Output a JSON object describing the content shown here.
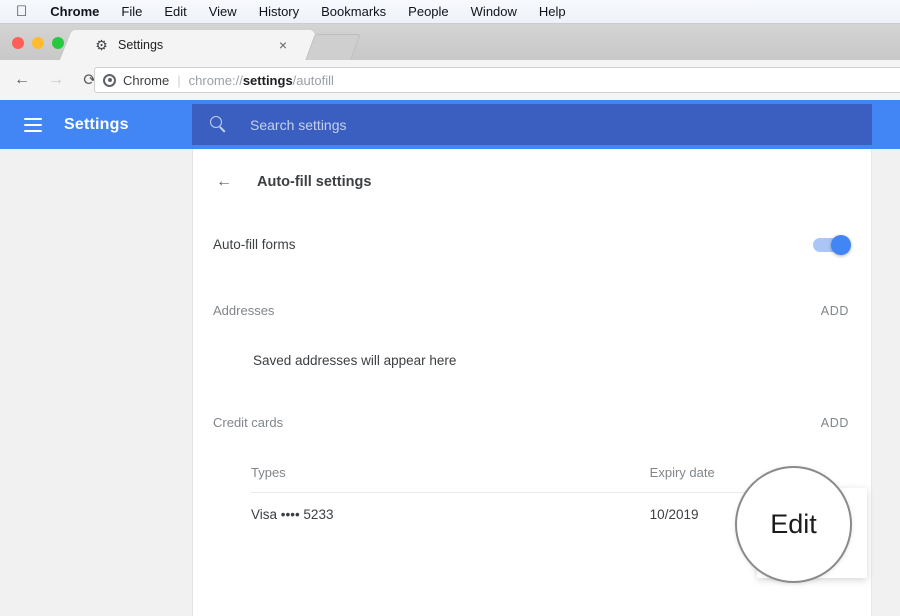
{
  "mac_menu": {
    "apple_icon": "apple-icon",
    "items": [
      {
        "label": "Chrome",
        "bold": true
      },
      {
        "label": "File",
        "bold": false
      },
      {
        "label": "Edit",
        "bold": false
      },
      {
        "label": "View",
        "bold": false
      },
      {
        "label": "History",
        "bold": false
      },
      {
        "label": "Bookmarks",
        "bold": false
      },
      {
        "label": "People",
        "bold": false
      },
      {
        "label": "Window",
        "bold": false
      },
      {
        "label": "Help",
        "bold": false
      }
    ]
  },
  "browser": {
    "tab": {
      "title": "Settings",
      "favicon": "gear-icon",
      "close_glyph": "×"
    },
    "nav": {
      "back_glyph": "←",
      "forward_glyph": "→",
      "reload_glyph": "⟳"
    },
    "omnibox": {
      "site_label": "Chrome",
      "separator": "|",
      "url_prefix": "chrome://",
      "url_bold": "settings",
      "url_suffix": "/autofill"
    }
  },
  "settings_header": {
    "menu_icon": "hamburger-icon",
    "title": "Settings",
    "search": {
      "icon": "search-icon",
      "placeholder": "Search settings",
      "value": ""
    },
    "accent_color": "#4285f4",
    "search_bg_color": "#3b5fc0"
  },
  "subpage": {
    "back_glyph": "←",
    "title": "Auto-fill settings",
    "autofill_forms": {
      "label": "Auto-fill forms",
      "toggle_on": true
    },
    "addresses": {
      "title": "Addresses",
      "add_label": "ADD",
      "empty_text": "Saved addresses will appear here"
    },
    "credit_cards": {
      "title": "Credit cards",
      "add_label": "ADD",
      "columns": [
        "Types",
        "Expiry date"
      ],
      "rows": [
        {
          "type": "Visa •••• 5233",
          "expiry": "10/2019"
        }
      ]
    }
  },
  "overlay": {
    "lens_label": "Edit"
  }
}
